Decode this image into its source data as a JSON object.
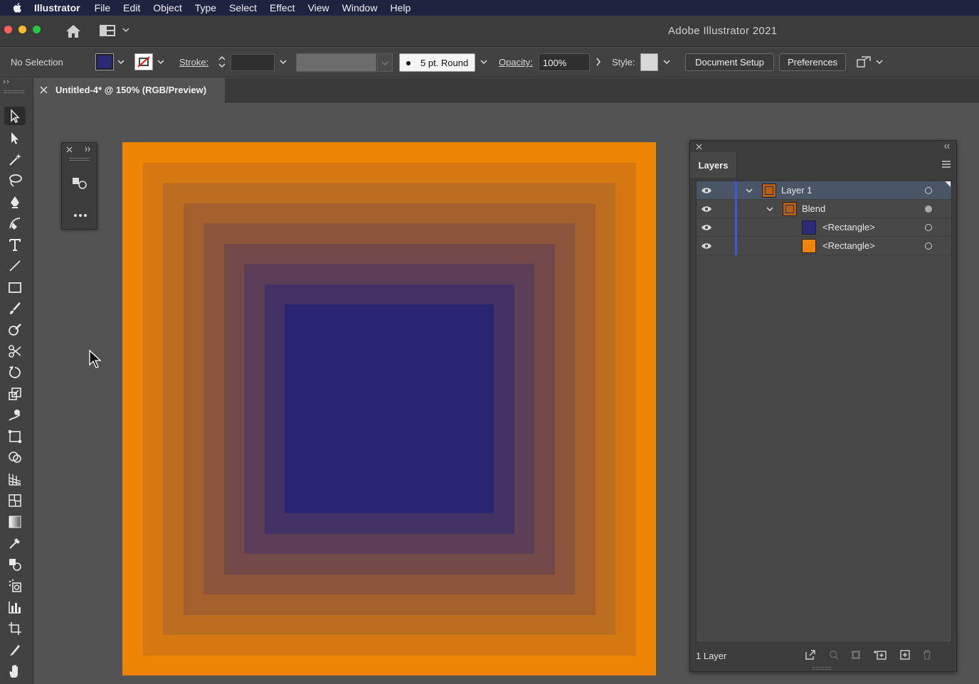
{
  "menubar": {
    "app_name": "Illustrator",
    "items": [
      "File",
      "Edit",
      "Object",
      "Type",
      "Select",
      "Effect",
      "View",
      "Window",
      "Help"
    ]
  },
  "appbar": {
    "title": "Adobe Illustrator 2021"
  },
  "controlbar": {
    "selection": "No Selection",
    "fill_color": "#2b2a78",
    "stroke_label": "Stroke:",
    "brush_label": "5 pt. Round",
    "opacity_label": "Opacity:",
    "opacity_value": "100%",
    "style_label": "Style:",
    "document_setup": "Document Setup",
    "preferences": "Preferences"
  },
  "tab": {
    "title": "Untitled-4* @ 150% (RGB/Preview)"
  },
  "artboard": {
    "outer_color": "#ee8404",
    "inner_color": "#2b2672",
    "steps": 9
  },
  "layers_panel": {
    "title": "Layers",
    "rows": [
      {
        "label": "Layer 1",
        "thumb_color": "#b5600e"
      },
      {
        "label": "Blend",
        "thumb_color": "#b5600e"
      },
      {
        "label": "<Rectangle>",
        "thumb_color": "#2b2a78"
      },
      {
        "label": "<Rectangle>",
        "thumb_color": "#ee8404"
      }
    ],
    "footer": "1 Layer"
  },
  "icons": {
    "apple": "apple-icon",
    "home": "home-icon",
    "workspace": "workspace-switcher-icon",
    "selection_tool": "selection-tool-icon",
    "direct_selection_tool": "direct-selection-tool-icon",
    "pen_tool": "pen-tool-icon",
    "type_tool": "type-tool-icon",
    "eye": "eye-icon"
  }
}
